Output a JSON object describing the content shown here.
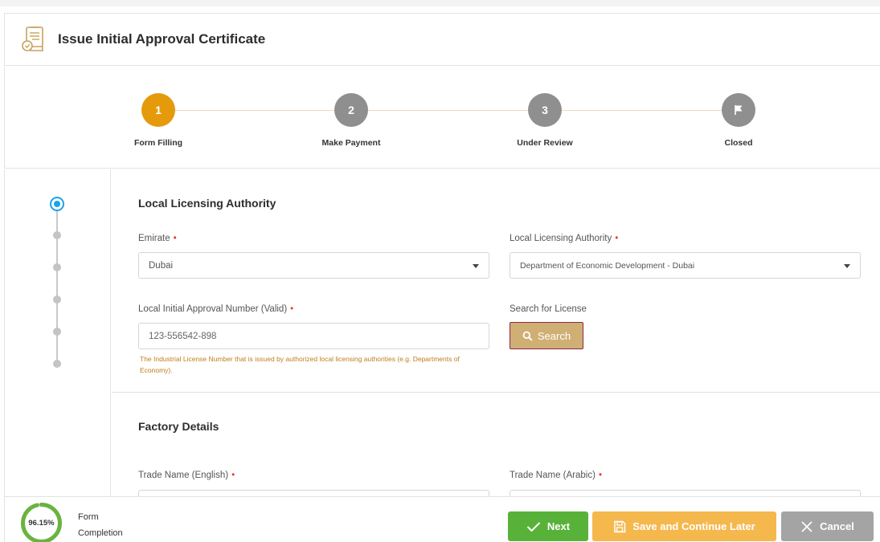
{
  "header": {
    "title": "Issue Initial Approval Certificate",
    "icon": "certificate-icon"
  },
  "stepper": {
    "steps": [
      {
        "number": "1",
        "label": "Form Filling",
        "state": "active"
      },
      {
        "number": "2",
        "label": "Make Payment",
        "state": "pending"
      },
      {
        "number": "3",
        "label": "Under Review",
        "state": "pending"
      },
      {
        "number": "",
        "label": "Closed",
        "state": "pending",
        "icon": "flag-icon"
      }
    ]
  },
  "sections": {
    "licensing": {
      "title": "Local Licensing Authority",
      "emirate": {
        "label": "Emirate",
        "required": "•",
        "value": "Dubai"
      },
      "authority": {
        "label": "Local Licensing Authority",
        "required": "•",
        "value": "Department of Economic Development - Dubai"
      },
      "approval_number": {
        "label": "Local Initial Approval Number (Valid)",
        "required": "•",
        "value": "123-556542-898"
      },
      "hint": "The Industrial License Number that is issued by authorized local licensing authorities (e.g. Departments of Economy).",
      "search_label": "Search for License",
      "search_button": "Search"
    },
    "factory": {
      "title": "Factory Details",
      "trade_name_en": {
        "label": "Trade Name (English)",
        "required": "•"
      },
      "trade_name_ar": {
        "label": "Trade Name (Arabic)",
        "required": "•"
      }
    }
  },
  "footer": {
    "completion_percent": "96.15%",
    "completion_value": 96.15,
    "completion_label_line1": "Form",
    "completion_label_line2": "Completion",
    "next": "Next",
    "save": "Save and Continue Later",
    "cancel": "Cancel"
  },
  "colors": {
    "active_step": "#e59a0b",
    "pending_step": "#8f8f8f",
    "next": "#58b23a",
    "save": "#f5b84d",
    "cancel": "#a4a4a4",
    "search": "#cfaf74",
    "hint": "#c07e1c",
    "rail_active": "#1aa3e8"
  }
}
